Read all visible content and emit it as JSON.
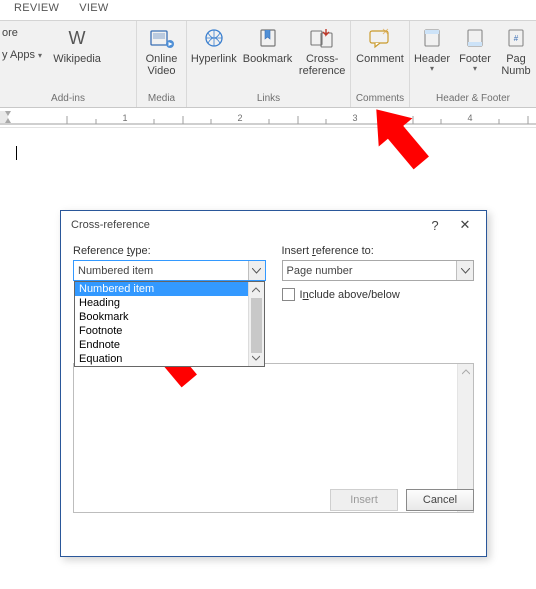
{
  "tabs": {
    "review": "REVIEW",
    "view": "VIEW"
  },
  "ribbon": {
    "addins": {
      "store": "ore",
      "myapps": "y Apps",
      "wikipedia": "Wikipedia",
      "group_label": "Add-ins"
    },
    "media": {
      "online_video": "Online\nVideo",
      "group_label": "Media"
    },
    "links": {
      "hyperlink": "Hyperlink",
      "bookmark": "Bookmark",
      "crossref": "Cross-\nreference",
      "group_label": "Links"
    },
    "comments": {
      "comment": "Comment",
      "group_label": "Comments"
    },
    "headerfooter": {
      "header": "Header",
      "footer": "Footer",
      "pagenum": "Pag\nNumb",
      "group_label": "Header & Footer"
    }
  },
  "ruler": {
    "marks": [
      "1",
      "2",
      "3",
      "4"
    ]
  },
  "dialog": {
    "title": "Cross-reference",
    "help": "?",
    "close": "✕",
    "ref_type_label": "Reference type:",
    "ref_type_value": "Numbered item",
    "ref_type_options": [
      "Numbered item",
      "Heading",
      "Bookmark",
      "Footnote",
      "Endnote",
      "Equation"
    ],
    "insert_ref_label": "Insert reference to:",
    "insert_ref_value": "Page number",
    "include_label": "Include above/below",
    "buttons": {
      "insert": "Insert",
      "cancel": "Cancel"
    }
  }
}
